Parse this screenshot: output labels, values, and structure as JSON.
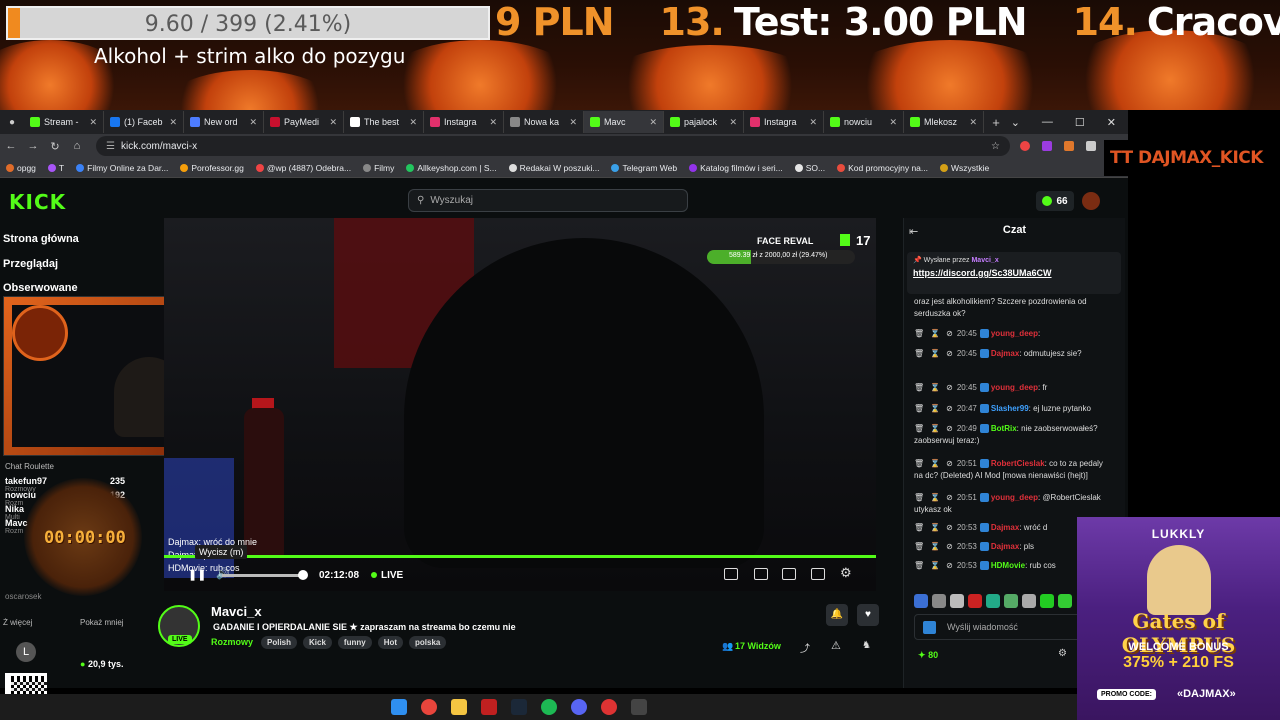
{
  "overlay": {
    "goal_text": "9.60 / 399 (2.41%)",
    "goal_fraction": 0.0241,
    "title": "Alkohol + strim alko do pozygu",
    "ticker": [
      {
        "text": "9 PLN",
        "accent": "#f0922a"
      },
      {
        "text": "13.",
        "accent": "#f0922a"
      },
      {
        "text": "Test: 3.00 PLN",
        "accent": "#ffffff"
      },
      {
        "text": "14.",
        "accent": "#f0922a"
      },
      {
        "text": "Cracovia",
        "accent": "#ffffff"
      }
    ],
    "streamer_tag": "TT DAJMAX_KICK"
  },
  "browser": {
    "tabs": [
      {
        "label": "Stream -",
        "color": "#53fc18"
      },
      {
        "label": "(1) Faceb",
        "color": "#1877f2"
      },
      {
        "label": "New ord",
        "color": "#4d7cff"
      },
      {
        "label": "PayMedi",
        "color": "#c8102e"
      },
      {
        "label": "The best",
        "color": "#ffffff"
      },
      {
        "label": "Instagra",
        "color": "#e1306c"
      },
      {
        "label": "Nowa ka",
        "color": "#888888"
      },
      {
        "label": "Mavc",
        "color": "#53fc18",
        "active": true
      },
      {
        "label": "pajalock",
        "color": "#53fc18"
      },
      {
        "label": "Instagra",
        "color": "#e1306c"
      },
      {
        "label": "nowciu",
        "color": "#53fc18"
      },
      {
        "label": "Mlekosz",
        "color": "#53fc18"
      }
    ],
    "url": "kick.com/mavci-x",
    "bookmarks": [
      "opgg",
      "T",
      "Filmy Online za Dar...",
      "Porofessor.gg",
      "@wp (4887) Odebra...",
      "Filmy",
      "Allkeyshop.com | S...",
      "Redakai W poszuki...",
      "Telegram Web",
      "Katalog filmów i seri...",
      "SO...",
      "Kod promocyjny na...",
      "Wszystkie"
    ]
  },
  "kick": {
    "logo": "KICK",
    "search_placeholder": "Wyszukaj",
    "coins": "66",
    "sidebar": {
      "home": "Strona główna",
      "browse": "Przeglądaj",
      "following": "Obserwowane",
      "roulette_title": "Chat Roulette",
      "roulette": [
        {
          "name": "takefun97",
          "sub": "Rozmowy",
          "value": "235"
        },
        {
          "name": "nowciu",
          "sub": "Rozm",
          "value": "192"
        },
        {
          "name": "Nika",
          "sub": "Multi",
          "value": ""
        },
        {
          "name": "Mavc",
          "sub": "Rozm",
          "value": ""
        }
      ],
      "oscar": "oscarosek",
      "less": "Ż więcej",
      "show_less": "Pokaż mniej",
      "viewers": "20,9 tys."
    },
    "timer": "00:00:00",
    "player": {
      "face_reval": "FACE REVAL",
      "face_count": "17",
      "goal_text": "589.39 zł z 2000,00 zł (29.47%)",
      "goal_fraction": 0.2947,
      "tooltip": "Wycisz (m)",
      "time": "02:12:08",
      "live": "LIVE",
      "volume": 0.95,
      "overlay_chat": [
        "Dajmax: wróć do mnie",
        "Dajmax: pls",
        "HDMovie: rub cos"
      ]
    },
    "stream": {
      "name": "Mavci_x",
      "live": "LIVE",
      "title": "GADANIE I OPIERDALANIE SIE ★ zapraszam na streama bo czemu nie",
      "category": "Rozmowy",
      "tags": [
        "Polish",
        "Kick",
        "funny",
        "Hot",
        "polska"
      ],
      "viewers": "17 Widzów"
    },
    "chat": {
      "title": "Czat",
      "pinned_by_prefix": "Wysłane przez",
      "pinned_by": "Mavci_x",
      "pinned_link": "https://discord.gg/Sc38UMa6CW",
      "partial": "oraz jest alkoholikiem? Szczere pozdrowienia od serduszka ok?",
      "messages": [
        {
          "time": "20:45",
          "user": "young_deep",
          "color": "#e0303a",
          "text": ""
        },
        {
          "time": "20:45",
          "user": "Dajmax",
          "color": "#e0303a",
          "text": "odmutujesz sie?"
        },
        {
          "time": "20:45",
          "user": "young_deep",
          "color": "#e0303a",
          "text": "fr"
        },
        {
          "time": "20:47",
          "user": "Slasher99",
          "color": "#3fa1ff",
          "text": "ej luzne pytanko"
        },
        {
          "time": "20:49",
          "user": "BotRix",
          "color": "#53fc18",
          "text": "nie zaobserwowałeś? zaobserwuj teraz:)"
        },
        {
          "time": "20:51",
          "user": "RobertCieslak",
          "color": "#e0303a",
          "text": "co to za pedaly na dc? (Deleted) AI Mod [mowa nienawiści (hejt)]"
        },
        {
          "time": "20:51",
          "user": "young_deep",
          "color": "#e0303a",
          "text": "@RobertCieslak utykasz ok"
        },
        {
          "time": "20:53",
          "user": "Dajmax",
          "color": "#e0303a",
          "text": "wróć d"
        },
        {
          "time": "20:53",
          "user": "Dajmax",
          "color": "#e0303a",
          "text": "pls"
        },
        {
          "time": "20:53",
          "user": "HDMovie",
          "color": "#53fc18",
          "text": "rub cos"
        }
      ],
      "input_placeholder": "Wyślij wiadomość",
      "points": "80"
    }
  },
  "ad": {
    "brand": "LUKKLY",
    "game": "Gates of OLYMPUS",
    "welcome": "WELCOME BONUS",
    "bonus": "375% + 210 FS",
    "promo_label": "PROMO CODE:",
    "promo_code": "«DAJMAX»"
  }
}
